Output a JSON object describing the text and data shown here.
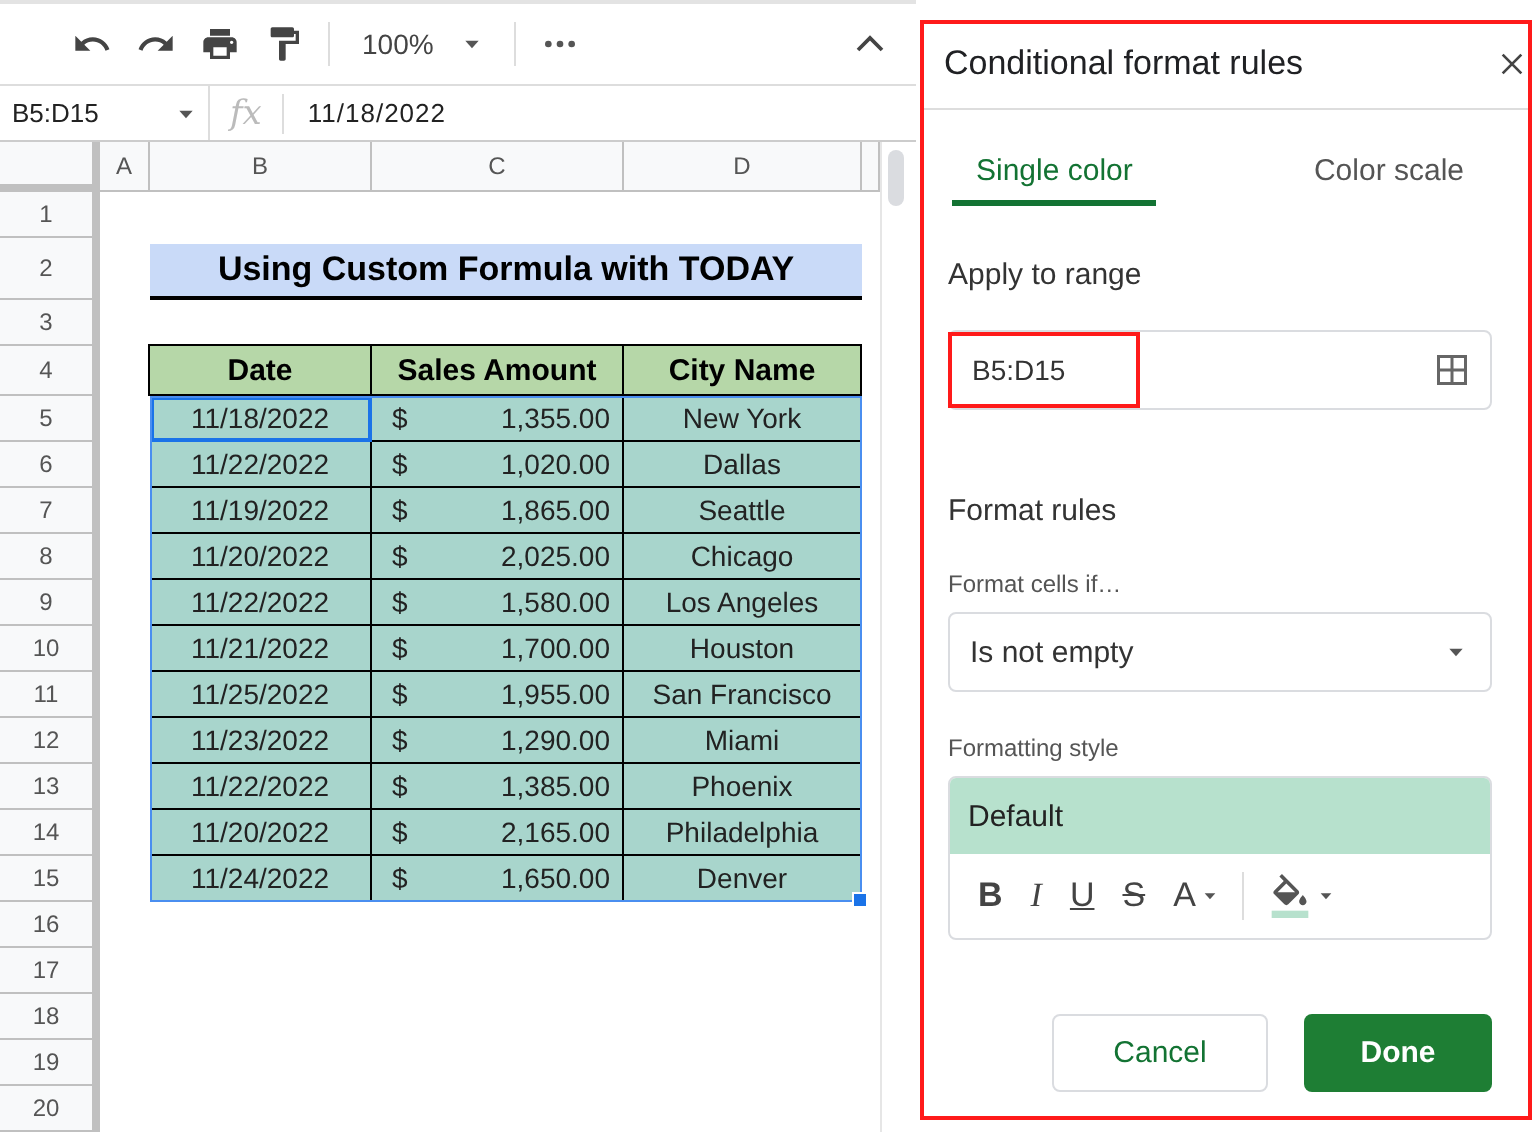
{
  "toolbar": {
    "zoom": "100%"
  },
  "formula_bar": {
    "name_box": "B5:D15",
    "fx": "fx",
    "value": "11/18/2022"
  },
  "columns": [
    "A",
    "B",
    "C",
    "D"
  ],
  "row_numbers": [
    "1",
    "2",
    "3",
    "4",
    "5",
    "6",
    "7",
    "8",
    "9",
    "10",
    "11",
    "12",
    "13",
    "14",
    "15",
    "16",
    "17",
    "18",
    "19",
    "20"
  ],
  "sheet": {
    "title": "Using Custom Formula with TODAY",
    "headers": [
      "Date",
      "Sales Amount",
      "City Name"
    ],
    "rows": [
      {
        "date": "11/18/2022",
        "currency": "$",
        "amount": "1,355.00",
        "city": "New York",
        "active": true
      },
      {
        "date": "11/22/2022",
        "currency": "$",
        "amount": "1,020.00",
        "city": "Dallas",
        "active": false
      },
      {
        "date": "11/19/2022",
        "currency": "$",
        "amount": "1,865.00",
        "city": "Seattle",
        "active": false
      },
      {
        "date": "11/20/2022",
        "currency": "$",
        "amount": "2,025.00",
        "city": "Chicago",
        "active": false
      },
      {
        "date": "11/22/2022",
        "currency": "$",
        "amount": "1,580.00",
        "city": "Los Angeles",
        "active": false
      },
      {
        "date": "11/21/2022",
        "currency": "$",
        "amount": "1,700.00",
        "city": "Houston",
        "active": false
      },
      {
        "date": "11/25/2022",
        "currency": "$",
        "amount": "1,955.00",
        "city": "San Francisco",
        "active": false
      },
      {
        "date": "11/23/2022",
        "currency": "$",
        "amount": "1,290.00",
        "city": "Miami",
        "active": false
      },
      {
        "date": "11/22/2022",
        "currency": "$",
        "amount": "1,385.00",
        "city": "Phoenix",
        "active": false
      },
      {
        "date": "11/20/2022",
        "currency": "$",
        "amount": "2,165.00",
        "city": "Philadelphia",
        "active": false
      },
      {
        "date": "11/24/2022",
        "currency": "$",
        "amount": "1,650.00",
        "city": "Denver",
        "active": false
      }
    ]
  },
  "panel": {
    "title": "Conditional format rules",
    "highlighted": true,
    "tabs": [
      {
        "label": "Single color",
        "selected": true
      },
      {
        "label": "Color scale",
        "selected": false
      }
    ],
    "apply_label": "Apply to range",
    "range": {
      "value": "B5:D15",
      "highlighted": true
    },
    "format_rules_label": "Format rules",
    "condition_label": "Format cells if…",
    "condition": "Is not empty",
    "style_label": "Formatting style",
    "preview": "Default",
    "style_buttons": [
      "B",
      "I",
      "U",
      "S",
      "A"
    ],
    "buttons": [
      {
        "label": "Cancel",
        "kind": "secondary"
      },
      {
        "label": "Done",
        "kind": "primary"
      }
    ]
  }
}
